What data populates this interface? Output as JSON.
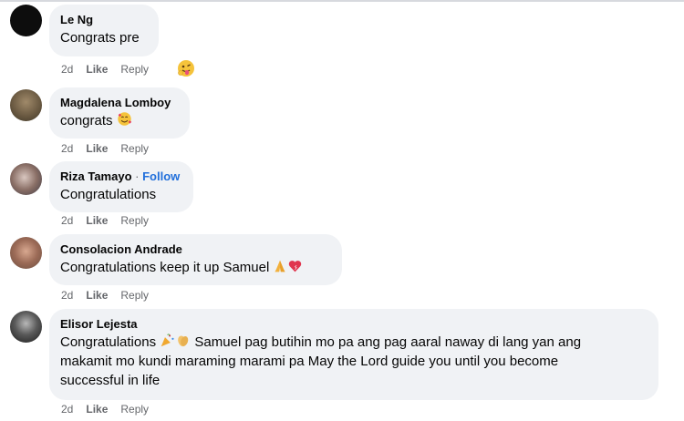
{
  "comments": [
    {
      "author": "Le Ng",
      "text": "Congrats pre",
      "time": "2d",
      "like": "Like",
      "reply": "Reply",
      "reaction_icon": "tongue-face-reaction-icon"
    },
    {
      "author": "Magdalena Lomboy",
      "text": "congrats",
      "emoji": "smiling-face-with-hearts",
      "time": "2d",
      "like": "Like",
      "reply": "Reply"
    },
    {
      "author": "Riza Tamayo",
      "separator": "·",
      "follow": "Follow",
      "text": "Congratulations",
      "time": "2d",
      "like": "Like",
      "reply": "Reply"
    },
    {
      "author": "Consolacion Andrade",
      "text": "Congratulations keep it up Samuel",
      "emoji": [
        "folded-hands",
        "heart"
      ],
      "time": "2d",
      "like": "Like",
      "reply": "Reply"
    },
    {
      "author": "Elisor Lejesta",
      "text_line1": "Samuel pag butihin mo pa ang pag aaral naway di lang yan ang",
      "text_prefix": "Congratulations",
      "text_line2": "makamit mo kundi maraming marami pa May the Lord guide you until you become",
      "text_line3": "successful in life",
      "emoji": [
        "party-popper",
        "clapping-hands"
      ],
      "time": "2d",
      "like": "Like",
      "reply": "Reply"
    }
  ],
  "colors": {
    "bubble": "#f0f2f5",
    "name": "#050505",
    "meta": "#65676b",
    "follow": "#216fdb"
  }
}
